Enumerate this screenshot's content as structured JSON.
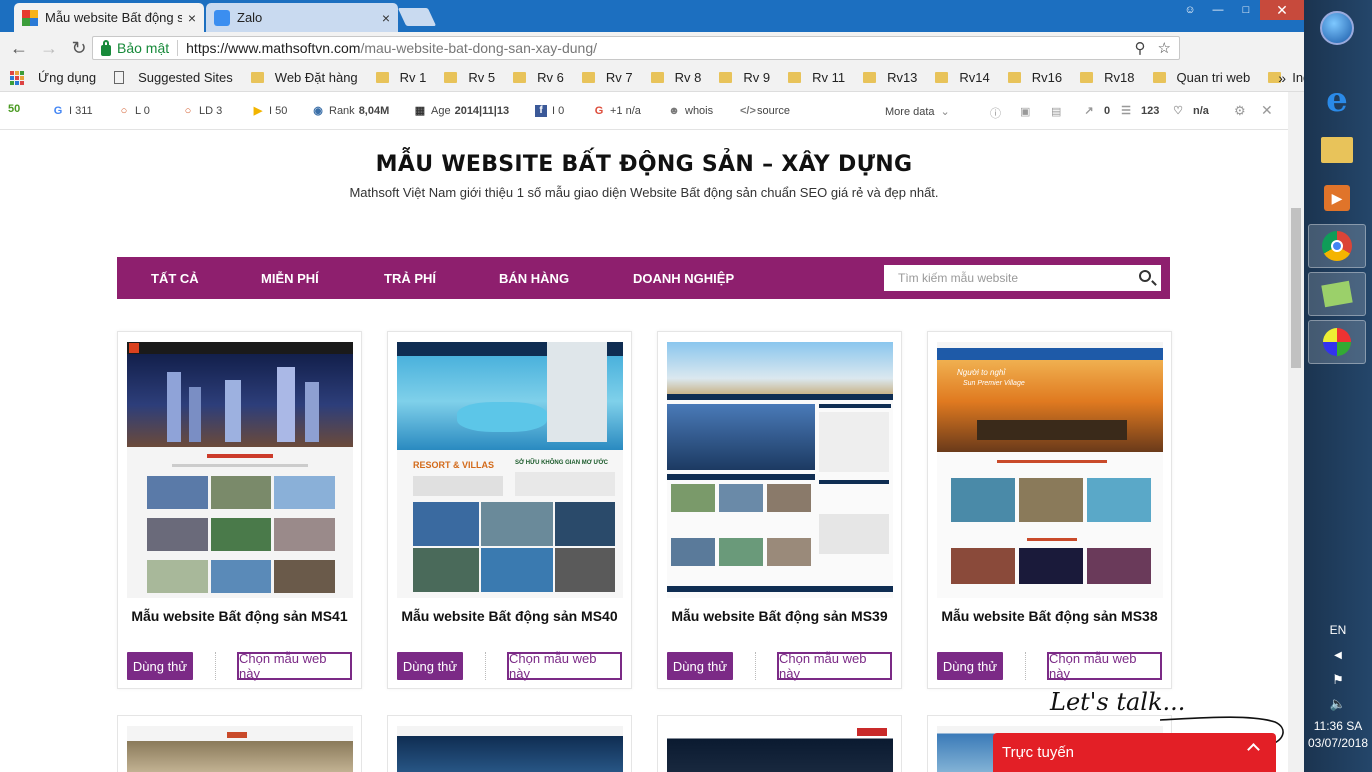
{
  "browser": {
    "tabs": [
      {
        "title": "Mẫu website Bất động sả",
        "close": "×"
      },
      {
        "title": "Zalo",
        "close": "×"
      }
    ],
    "omnibox": {
      "secure_label": "Bảo mật",
      "url_host": "https://www.mathsoftvn.com",
      "url_path": "/mau-website-bat-dong-san-xay-dung/"
    },
    "bookmarks": [
      "Ứng dụng",
      "Suggested Sites",
      "Web Đặt hàng",
      "Rv 1",
      "Rv 5",
      "Rv 6",
      "Rv 7",
      "Rv 8",
      "Rv 9",
      "Rv 11",
      "Rv13",
      "Rv14",
      "Rv16",
      "Rv18",
      "Quan tri web",
      "Index"
    ],
    "bookmarks_more": "»"
  },
  "seo_bar": {
    "google": "I 311",
    "l": "L 0",
    "ld": "LD 3",
    "i": "I 50",
    "rank_label": "Rank",
    "rank_value": "8,04M",
    "age_label": "Age",
    "age_value": "2014|11|13",
    "facebook": "I 0",
    "gplus": "+1 n/a",
    "whois": "whois",
    "source": "source",
    "more_data": "More data",
    "links_out": "0",
    "count": "123",
    "heart": "n/a"
  },
  "page": {
    "title": "MẪU WEBSITE BẤT ĐỘNG SẢN – XÂY DỰNG",
    "subtitle": "Mathsoft Việt Nam giới thiệu 1 số mẫu giao diện Website Bất động sản chuẩn SEO giá rẻ và đẹp nhất.",
    "categories": [
      "TẤT CẢ",
      "MIỄN PHÍ",
      "TRẢ PHÍ",
      "BÁN HÀNG",
      "DOANH NGHIỆP"
    ],
    "search_placeholder": "Tìm kiếm mẫu website",
    "cards": [
      {
        "title": "Mẫu website Bất động sản MS41",
        "try": "Dùng thử",
        "choose": "Chọn mẫu web này"
      },
      {
        "title": "Mẫu website Bất động sản MS40",
        "try": "Dùng thử",
        "choose": "Chọn mẫu web này"
      },
      {
        "title": "Mẫu website Bất động sản MS39",
        "try": "Dùng thử",
        "choose": "Chọn mẫu web này"
      },
      {
        "title": "Mẫu website Bất động sản MS38",
        "try": "Dùng thử",
        "choose": "Chọn mẫu web này"
      }
    ],
    "thumb_texts": {
      "ms40_heading": "RESORT & VILLAS",
      "ms40_sub": "SỞ HỮU KHÔNG GIAN MƠ ƯỚC",
      "ms38_heading": "Người to nghỉ",
      "ms38_sub": "Sun Premier Village"
    }
  },
  "chat": {
    "lets_talk": "Let's talk...",
    "label": "Trực tuyến"
  },
  "taskbar": {
    "language": "EN",
    "time": "11:36 SA",
    "date": "03/07/2018"
  },
  "colors": {
    "tabstrip": "#1c6fc0",
    "category_bar": "#8e1f6e",
    "button_purple": "#7b2a86",
    "chat_red": "#e31f26"
  }
}
